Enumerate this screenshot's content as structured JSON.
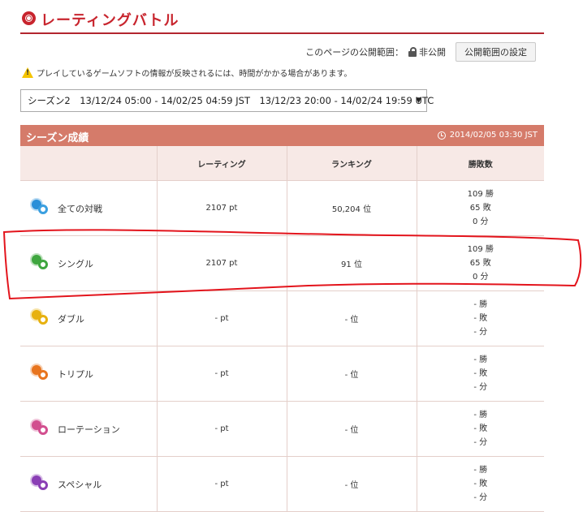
{
  "header": {
    "title": "レーティングバトル"
  },
  "visibility": {
    "label": "このページの公開範囲：",
    "value": "非公開",
    "button": "公開範囲の設定"
  },
  "notice": {
    "text": "プレイしているゲームソフトの情報が反映されるには、時間がかかる場合があります。"
  },
  "season_select": {
    "selected": "シーズン2　13/12/24 05:00 - 14/02/25 04:59 JST　13/12/23 20:00 - 14/02/24 19:59 UTC"
  },
  "results": {
    "title": "シーズン成績",
    "timestamp": "2014/02/05 03:30 JST",
    "columns": {
      "mode": "",
      "rating": "レーティング",
      "ranking": "ランキング",
      "record": "勝敗数"
    },
    "rows": [
      {
        "mode": "全ての対戦",
        "icon": "all-battles-icon",
        "rating": "2107 pt",
        "ranking": "50,204 位",
        "wins": "109 勝",
        "losses": "65 敗",
        "draws": "0 分",
        "sun_color": "#2a8fd8",
        "ring_color": "#3a9fe0"
      },
      {
        "mode": "シングル",
        "icon": "single-battle-icon",
        "rating": "2107 pt",
        "ranking": "91 位",
        "wins": "109 勝",
        "losses": "65 敗",
        "draws": "0 分",
        "sun_color": "#3fa63f",
        "ring_color": "#3fa63f"
      },
      {
        "mode": "ダブル",
        "icon": "double-battle-icon",
        "rating": "- pt",
        "ranking": "- 位",
        "wins": "- 勝",
        "losses": "- 敗",
        "draws": "- 分",
        "sun_color": "#e7b10f",
        "ring_color": "#e7b10f"
      },
      {
        "mode": "トリプル",
        "icon": "triple-battle-icon",
        "rating": "- pt",
        "ranking": "- 位",
        "wins": "- 勝",
        "losses": "- 敗",
        "draws": "- 分",
        "sun_color": "#e8751f",
        "ring_color": "#e8751f"
      },
      {
        "mode": "ローテーション",
        "icon": "rotation-battle-icon",
        "rating": "- pt",
        "ranking": "- 位",
        "wins": "- 勝",
        "losses": "- 敗",
        "draws": "- 分",
        "sun_color": "#d24f8f",
        "ring_color": "#d24f8f"
      },
      {
        "mode": "スペシャル",
        "icon": "special-battle-icon",
        "rating": "- pt",
        "ranking": "- 位",
        "wins": "- 勝",
        "losses": "- 敗",
        "draws": "- 分",
        "sun_color": "#8a3fb5",
        "ring_color": "#8a3fb5"
      }
    ]
  },
  "colors": {
    "brand": "#c8252e",
    "panel_header": "#d57b6a",
    "table_header": "#f7e9e6",
    "value_red": "#a0282e",
    "highlight": "#e3141c"
  }
}
